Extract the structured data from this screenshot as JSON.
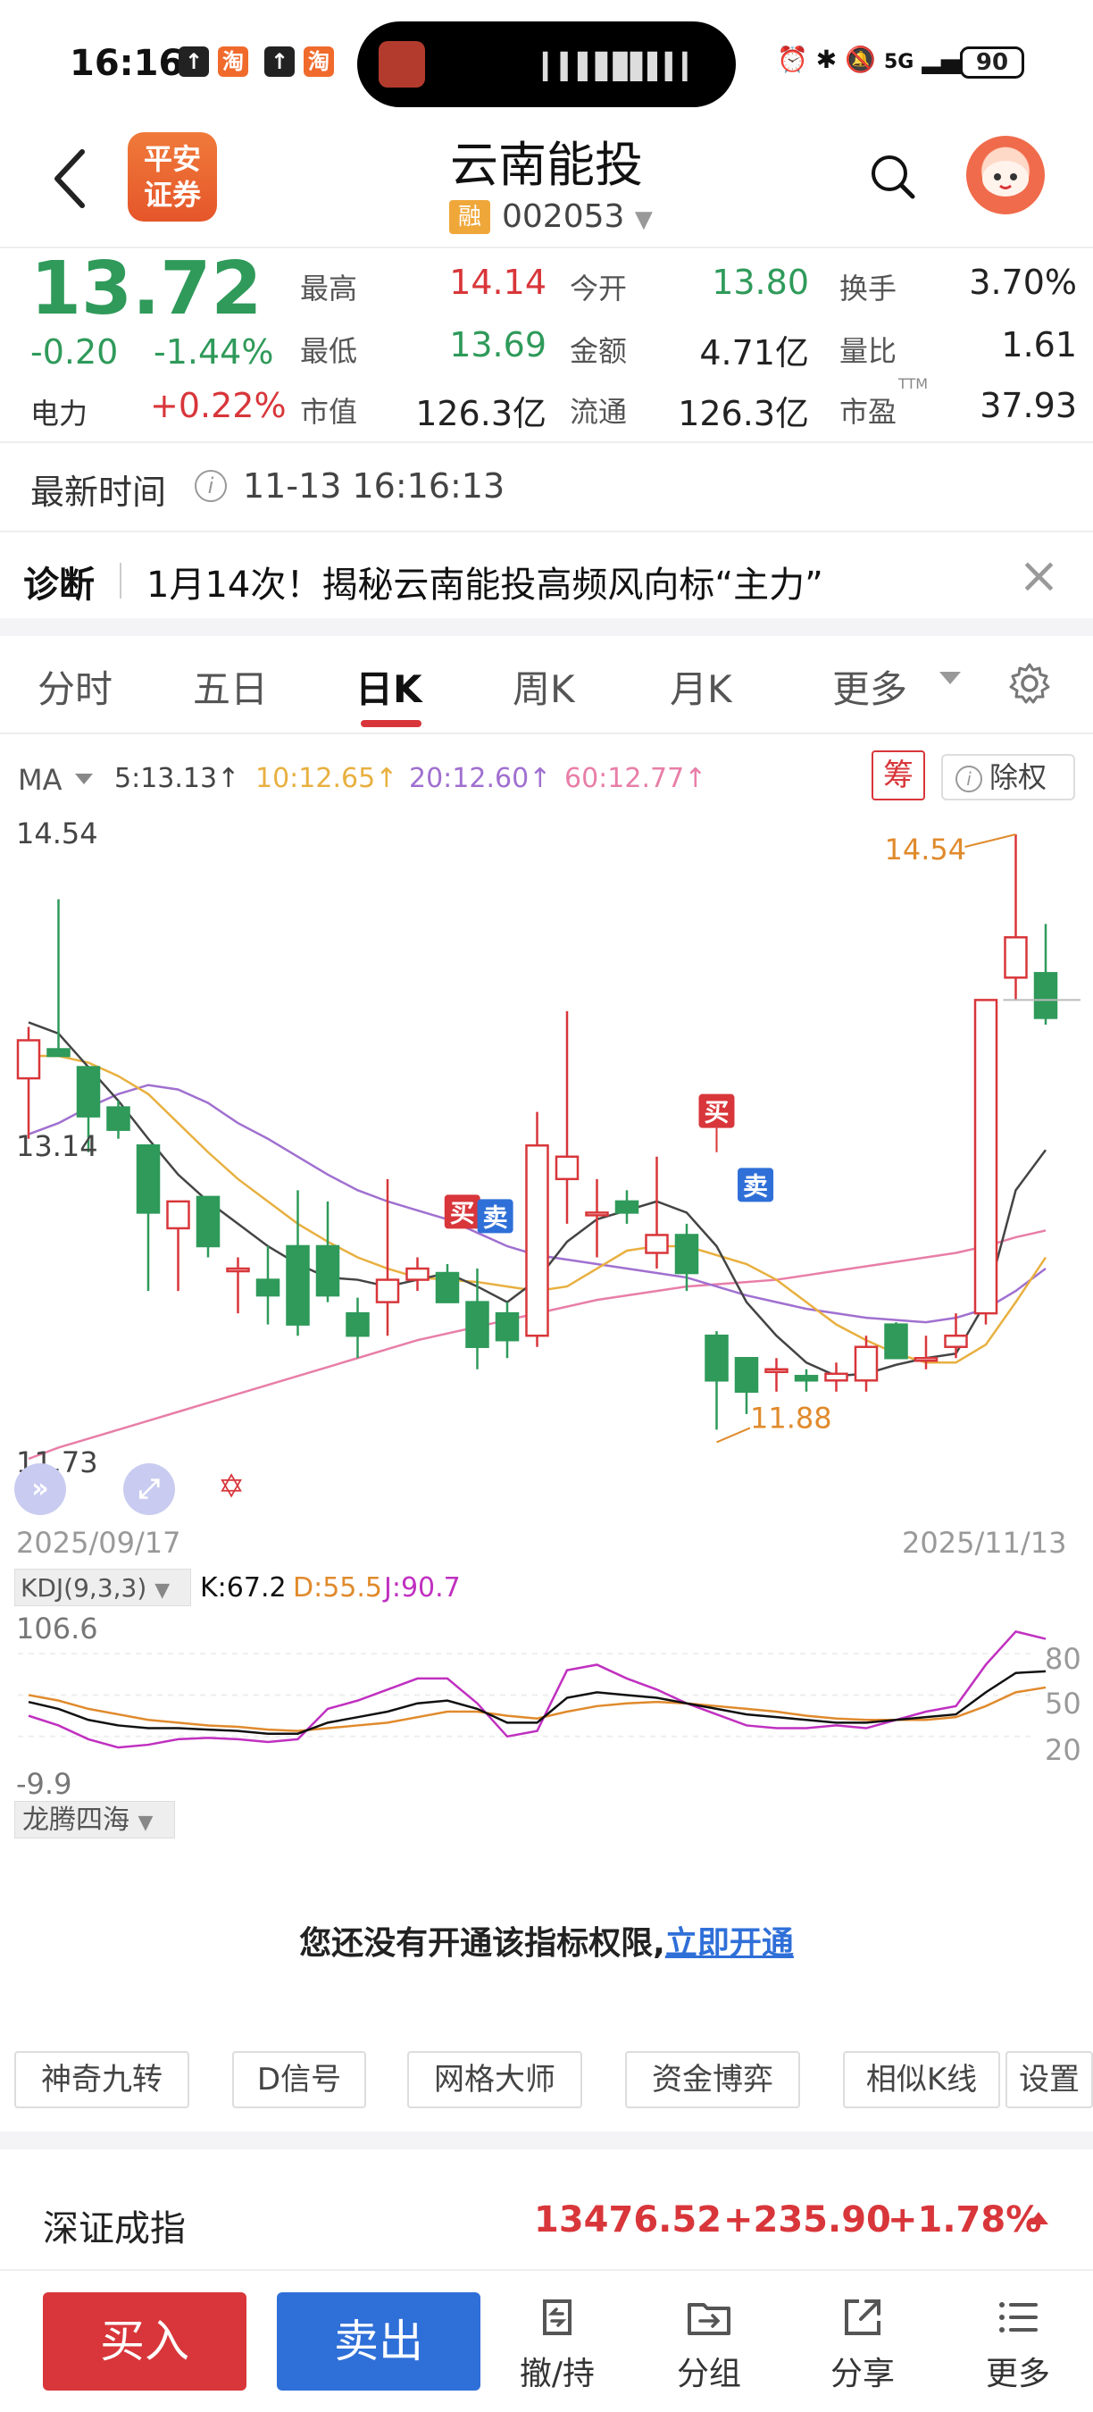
{
  "status_bar": {
    "time": "16:16",
    "badge_labels": [
      "淘",
      "淘"
    ],
    "network": "5G",
    "battery": "90"
  },
  "header": {
    "logo_text": "平安证券",
    "stock_name": "云南能投",
    "margin_badge": "融",
    "stock_code": "002053"
  },
  "quote": {
    "price": "13.72",
    "change": "-0.20",
    "change_pct": "-1.44%",
    "sector_name": "电力",
    "sector_change": "+0.22%",
    "fields": [
      {
        "label": "最高",
        "value": "14.14",
        "color": "#d8363a"
      },
      {
        "label": "今开",
        "value": "13.80",
        "color": "#2f9a5a"
      },
      {
        "label": "换手",
        "value": "3.70%",
        "color": "#222222"
      },
      {
        "label": "最低",
        "value": "13.69",
        "color": "#2f9a5a"
      },
      {
        "label": "金额",
        "value": "4.71亿",
        "color": "#222222"
      },
      {
        "label": "量比",
        "value": "1.61",
        "color": "#222222"
      },
      {
        "label": "市值",
        "value": "126.3亿",
        "color": "#222222"
      },
      {
        "label": "流通",
        "value": "126.3亿",
        "color": "#222222"
      },
      {
        "label": "市盈",
        "value": "37.93",
        "color": "#222222"
      }
    ],
    "pe_sup": "TTM"
  },
  "latest": {
    "label": "最新时间",
    "time": "11-13 16:16:13"
  },
  "diagnosis": {
    "label": "诊断",
    "text": "1月14次！揭秘云南能投高频风向标“主力”"
  },
  "tabs": [
    "分时",
    "五日",
    "日K",
    "周K",
    "月K",
    "更多"
  ],
  "active_tab": "日K",
  "ma": {
    "label": "MA",
    "items": [
      {
        "text": "5:13.13↑",
        "color": "#444444"
      },
      {
        "text": "10:12.65↑",
        "color": "#e8b040"
      },
      {
        "text": "20:12.60↑",
        "color": "#a070d0"
      },
      {
        "text": "60:12.77↑",
        "color": "#e87ea8"
      }
    ],
    "chip_button": "筹",
    "adjust_button": "除权"
  },
  "chart_data": {
    "type": "candlestick",
    "y_axis_labels": [
      "14.54",
      "13.14",
      "11.73"
    ],
    "ylim": [
      11.73,
      14.54
    ],
    "start_date": "2025/09/17",
    "end_date": "2025/11/13",
    "high_annotation": "14.54",
    "low_annotation": "11.88",
    "signals": [
      "买",
      "卖",
      "买",
      "卖"
    ],
    "candles": [
      {
        "o": 13.45,
        "h": 13.68,
        "l": 13.18,
        "c": 13.62
      },
      {
        "o": 13.58,
        "h": 14.25,
        "l": 13.55,
        "c": 13.55
      },
      {
        "o": 13.5,
        "h": 13.5,
        "l": 13.12,
        "c": 13.28
      },
      {
        "o": 13.32,
        "h": 13.35,
        "l": 13.18,
        "c": 13.22
      },
      {
        "o": 13.15,
        "h": 13.15,
        "l": 12.5,
        "c": 12.85
      },
      {
        "o": 12.78,
        "h": 12.85,
        "l": 12.5,
        "c": 12.9
      },
      {
        "o": 12.92,
        "h": 12.92,
        "l": 12.65,
        "c": 12.7
      },
      {
        "o": 12.6,
        "h": 12.65,
        "l": 12.4,
        "c": 12.6
      },
      {
        "o": 12.55,
        "h": 12.7,
        "l": 12.35,
        "c": 12.48
      },
      {
        "o": 12.7,
        "h": 12.95,
        "l": 12.3,
        "c": 12.35
      },
      {
        "o": 12.7,
        "h": 12.9,
        "l": 12.45,
        "c": 12.48
      },
      {
        "o": 12.4,
        "h": 12.47,
        "l": 12.2,
        "c": 12.3
      },
      {
        "o": 12.45,
        "h": 13.0,
        "l": 12.3,
        "c": 12.55
      },
      {
        "o": 12.55,
        "h": 12.65,
        "l": 12.5,
        "c": 12.6
      },
      {
        "o": 12.58,
        "h": 12.62,
        "l": 12.48,
        "c": 12.45
      },
      {
        "o": 12.45,
        "h": 12.6,
        "l": 12.15,
        "c": 12.25
      },
      {
        "o": 12.4,
        "h": 12.45,
        "l": 12.2,
        "c": 12.28
      },
      {
        "o": 12.3,
        "h": 13.3,
        "l": 12.25,
        "c": 13.15
      },
      {
        "o": 13.0,
        "h": 13.75,
        "l": 12.8,
        "c": 13.1
      },
      {
        "o": 12.85,
        "h": 13.0,
        "l": 12.65,
        "c": 12.85
      },
      {
        "o": 12.9,
        "h": 12.95,
        "l": 12.8,
        "c": 12.85
      },
      {
        "o": 12.67,
        "h": 13.1,
        "l": 12.6,
        "c": 12.75
      },
      {
        "o": 12.75,
        "h": 12.8,
        "l": 12.5,
        "c": 12.58
      },
      {
        "o": 12.3,
        "h": 12.32,
        "l": 11.88,
        "c": 12.1
      },
      {
        "o": 12.2,
        "h": 12.2,
        "l": 11.95,
        "c": 12.05
      },
      {
        "o": 12.15,
        "h": 12.2,
        "l": 12.05,
        "c": 12.15
      },
      {
        "o": 12.12,
        "h": 12.15,
        "l": 12.05,
        "c": 12.1
      },
      {
        "o": 12.1,
        "h": 12.18,
        "l": 12.05,
        "c": 12.13
      },
      {
        "o": 12.1,
        "h": 12.3,
        "l": 12.05,
        "c": 12.25
      },
      {
        "o": 12.35,
        "h": 12.36,
        "l": 12.2,
        "c": 12.2
      },
      {
        "o": 12.2,
        "h": 12.3,
        "l": 12.15,
        "c": 12.2
      },
      {
        "o": 12.25,
        "h": 12.4,
        "l": 12.2,
        "c": 12.3
      },
      {
        "o": 12.4,
        "h": 13.8,
        "l": 12.35,
        "c": 13.8
      },
      {
        "o": 13.9,
        "h": 14.54,
        "l": 13.8,
        "c": 14.08
      },
      {
        "o": 13.92,
        "h": 14.14,
        "l": 13.69,
        "c": 13.72
      }
    ],
    "ma5": [
      13.7,
      13.65,
      13.5,
      13.35,
      13.18,
      13.02,
      12.9,
      12.8,
      12.7,
      12.62,
      12.56,
      12.55,
      12.52,
      12.55,
      12.58,
      12.52,
      12.45,
      12.55,
      12.72,
      12.82,
      12.86,
      12.9,
      12.85,
      12.7,
      12.45,
      12.3,
      12.18,
      12.12,
      12.13,
      12.17,
      12.2,
      12.22,
      12.45,
      12.95,
      13.13
    ],
    "ma10": [
      13.55,
      13.55,
      13.52,
      13.46,
      13.38,
      13.25,
      13.12,
      13.0,
      12.9,
      12.8,
      12.72,
      12.65,
      12.6,
      12.56,
      12.55,
      12.54,
      12.52,
      12.5,
      12.52,
      12.6,
      12.68,
      12.7,
      12.7,
      12.66,
      12.62,
      12.55,
      12.45,
      12.35,
      12.28,
      12.22,
      12.18,
      12.18,
      12.26,
      12.45,
      12.65
    ],
    "ma20": [
      13.2,
      13.25,
      13.32,
      13.38,
      13.42,
      13.4,
      13.34,
      13.25,
      13.18,
      13.1,
      13.02,
      12.95,
      12.9,
      12.86,
      12.82,
      12.76,
      12.7,
      12.66,
      12.64,
      12.62,
      12.6,
      12.58,
      12.56,
      12.52,
      12.48,
      12.45,
      12.42,
      12.4,
      12.38,
      12.37,
      12.36,
      12.38,
      12.42,
      12.5,
      12.6
    ],
    "ma60": [
      11.75,
      11.8,
      11.84,
      11.88,
      11.92,
      11.96,
      12.0,
      12.04,
      12.08,
      12.12,
      12.16,
      12.2,
      12.24,
      12.28,
      12.31,
      12.34,
      12.37,
      12.4,
      12.43,
      12.46,
      12.48,
      12.5,
      12.52,
      12.53,
      12.54,
      12.55,
      12.57,
      12.59,
      12.61,
      12.63,
      12.65,
      12.67,
      12.7,
      12.74,
      12.77
    ]
  },
  "kdj": {
    "label": "KDJ(9,3,3)",
    "k": "K:67.2",
    "d": "D:55.5",
    "j": "J:90.7",
    "y_top": "106.6",
    "y_bottom": "-9.9",
    "levels": [
      "80",
      "50",
      "20"
    ],
    "ylim": [
      -9.9,
      106.6
    ],
    "k_series": [
      45,
      40,
      32,
      28,
      26,
      26,
      25,
      24,
      22,
      22,
      30,
      34,
      38,
      44,
      46,
      40,
      30,
      30,
      48,
      52,
      50,
      48,
      44,
      40,
      36,
      34,
      32,
      30,
      30,
      32,
      34,
      36,
      52,
      66,
      67.2
    ],
    "d_series": [
      50,
      46,
      40,
      36,
      32,
      30,
      28,
      27,
      25,
      24,
      26,
      28,
      30,
      34,
      38,
      38,
      35,
      33,
      38,
      42,
      44,
      45,
      44,
      42,
      40,
      38,
      35,
      33,
      32,
      32,
      32,
      34,
      42,
      52,
      55.5
    ],
    "j_series": [
      35,
      28,
      18,
      12,
      14,
      18,
      19,
      18,
      16,
      18,
      40,
      46,
      54,
      62,
      62,
      44,
      20,
      24,
      68,
      72,
      62,
      54,
      44,
      36,
      28,
      26,
      26,
      28,
      26,
      32,
      38,
      42,
      72,
      96,
      90.7
    ]
  },
  "indicator": {
    "name": "龙腾四海",
    "notice": "您还没有开通该指标权限,",
    "link": "立即开通"
  },
  "tools": [
    "神奇九转",
    "D信号",
    "网格大师",
    "资金博弈",
    "相似K线",
    "设置"
  ],
  "index_bar": {
    "name": "深证成指",
    "value": "13476.52",
    "change": "+235.90",
    "change_pct": "+1.78%"
  },
  "bottom_nav": {
    "buy": "买入",
    "sell": "卖出",
    "items": [
      "撤/持",
      "分组",
      "分享",
      "更多"
    ]
  }
}
